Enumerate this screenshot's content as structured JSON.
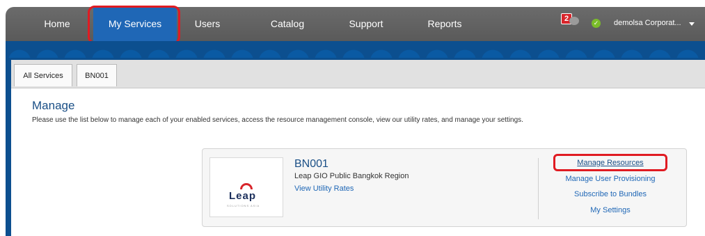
{
  "nav": {
    "items": [
      {
        "label": "Home"
      },
      {
        "label": "My Services"
      },
      {
        "label": "Users"
      },
      {
        "label": "Catalog"
      },
      {
        "label": "Support"
      },
      {
        "label": "Reports"
      }
    ],
    "active": "My Services",
    "notification_count": "2",
    "account_label": "demolsa Corporat...",
    "status_icon": "check-circle-icon",
    "colors": {
      "bar": "#5f5f5f",
      "active": "#1f67b6",
      "highlight": "#e01b22",
      "status": "#7bbd2a"
    }
  },
  "tabs": [
    {
      "label": "All Services"
    },
    {
      "label": "BN001"
    }
  ],
  "manage": {
    "title": "Manage",
    "description": "Please use the list below to manage each of your enabled services, access the resource management console, view our utility rates, and manage your settings."
  },
  "service": {
    "logo_text": "Leap",
    "logo_subtext": "SOLUTIONS ASIA",
    "name": "BN001",
    "region": "Leap GIO Public Bangkok Region",
    "rates_link": "View Utility Rates",
    "actions": [
      {
        "label": "Manage Resources"
      },
      {
        "label": "Manage User Provisioning"
      },
      {
        "label": "Subscribe to Bundles"
      },
      {
        "label": "My Settings"
      }
    ]
  }
}
